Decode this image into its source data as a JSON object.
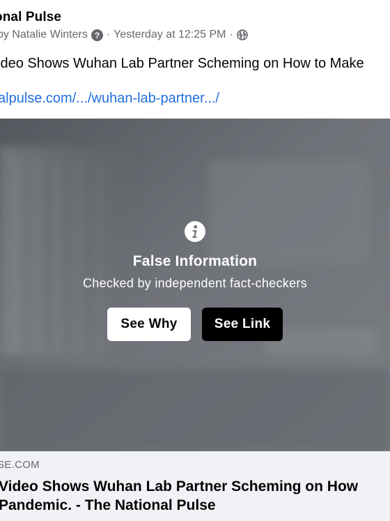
{
  "post": {
    "page_name": "onal Pulse",
    "author_prefix": "by Natalie Winters",
    "timestamp": "Yesterday at 12:25 PM",
    "separator": "·",
    "text": "ideo Shows Wuhan Lab Partner Scheming on How to Make",
    "link": "alpulse.com/.../wuhan-lab-partner.../"
  },
  "warning": {
    "title": "False Information",
    "subtitle": "Checked by independent fact-checkers",
    "see_why_label": "See Why",
    "see_link_label": "See Link"
  },
  "preview": {
    "domain": "SE.COM",
    "title_line1": "Video Shows Wuhan Lab Partner Scheming on How",
    "title_line2": "Pandemic. - The National Pulse"
  },
  "icons": {
    "help": "question-circle-icon",
    "audience": "globe-icon",
    "info": "info-icon"
  },
  "colors": {
    "link": "#216fdb",
    "meta": "#65676b",
    "overlay": "#6f7278",
    "preview_bg": "#f0f2f5"
  }
}
